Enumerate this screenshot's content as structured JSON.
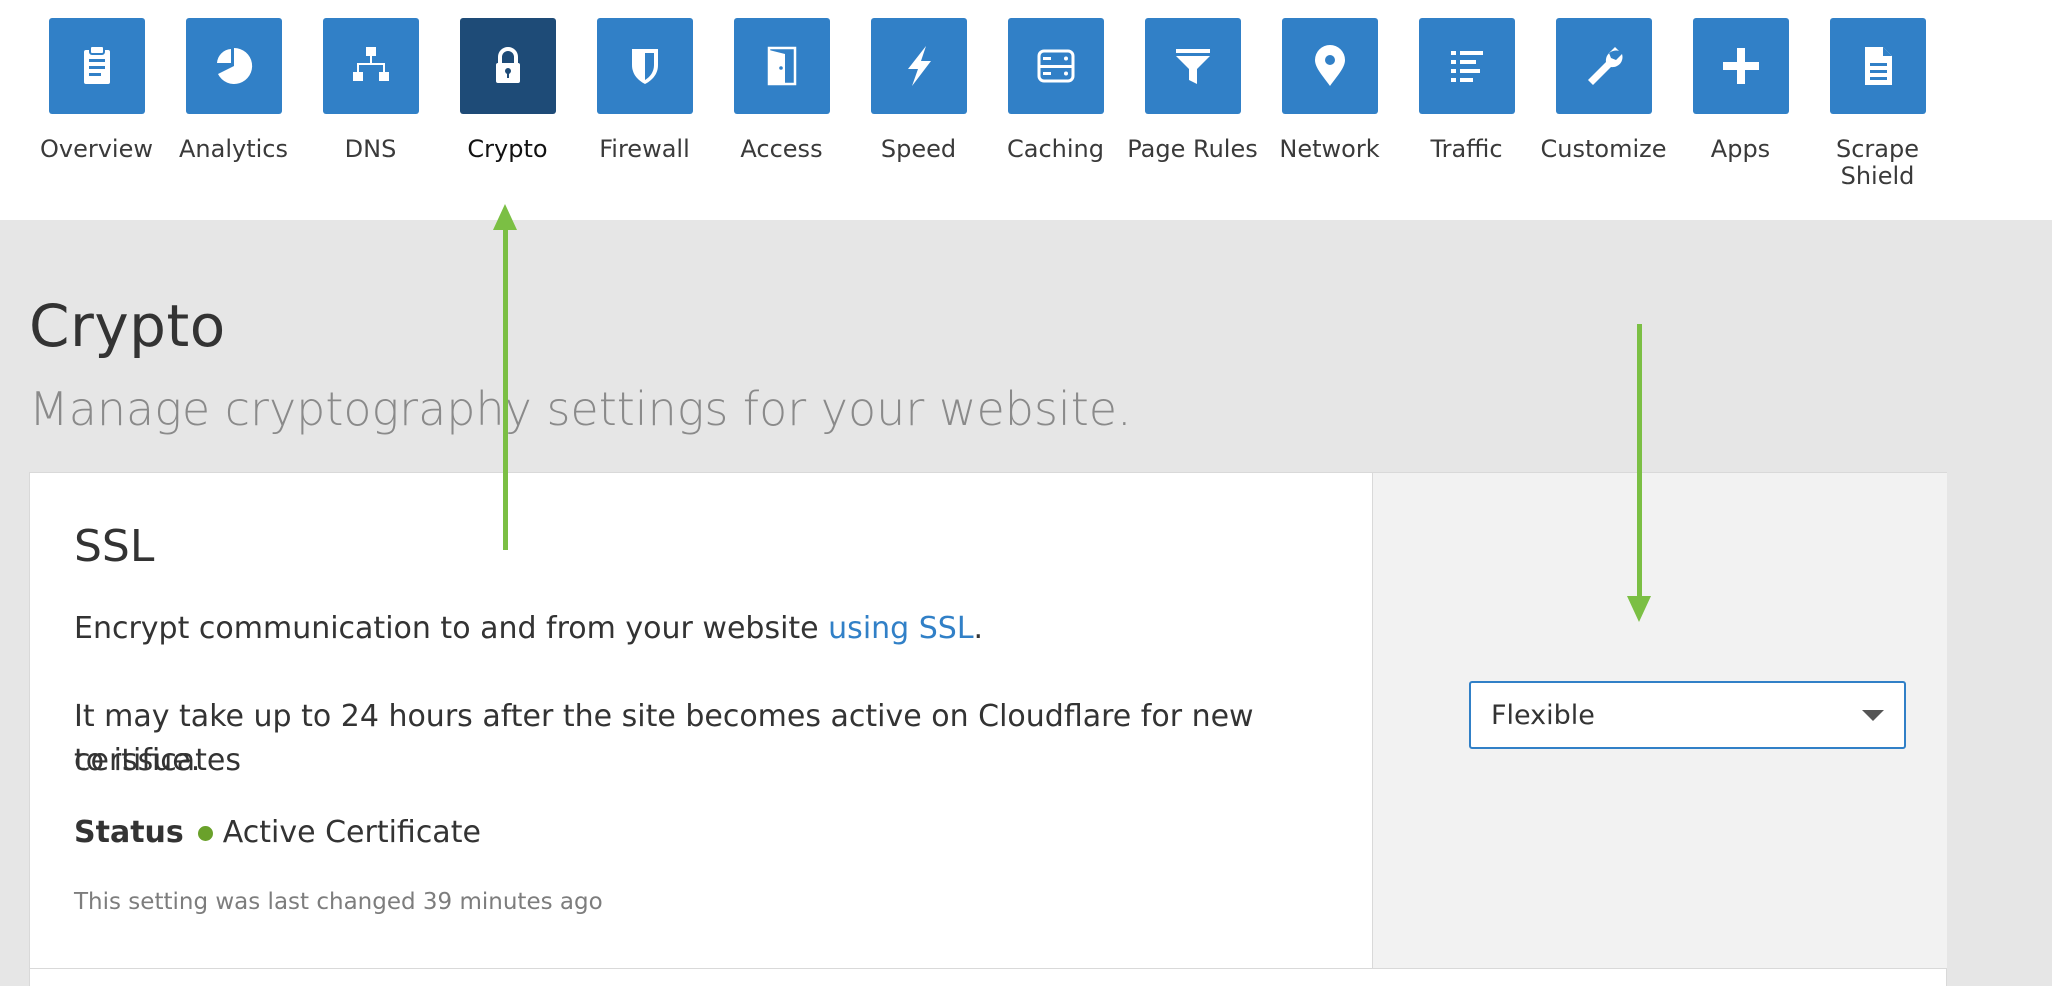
{
  "nav": {
    "items": [
      {
        "label": "Overview",
        "icon": "clipboard-icon",
        "active": false
      },
      {
        "label": "Analytics",
        "icon": "pie-chart-icon",
        "active": false
      },
      {
        "label": "DNS",
        "icon": "network-tree-icon",
        "active": false
      },
      {
        "label": "Crypto",
        "icon": "lock-icon",
        "active": true
      },
      {
        "label": "Firewall",
        "icon": "shield-icon",
        "active": false
      },
      {
        "label": "Access",
        "icon": "door-icon",
        "active": false
      },
      {
        "label": "Speed",
        "icon": "lightning-icon",
        "active": false
      },
      {
        "label": "Caching",
        "icon": "server-icon",
        "active": false
      },
      {
        "label": "Page Rules",
        "icon": "filter-icon",
        "active": false
      },
      {
        "label": "Network",
        "icon": "location-pin-icon",
        "active": false
      },
      {
        "label": "Traffic",
        "icon": "list-icon",
        "active": false
      },
      {
        "label": "Customize",
        "icon": "wrench-icon",
        "active": false
      },
      {
        "label": "Apps",
        "icon": "plus-icon",
        "active": false
      },
      {
        "label": "Scrape\nShield",
        "icon": "document-icon",
        "active": false
      }
    ]
  },
  "page": {
    "title": "Crypto",
    "subtitle": "Manage cryptography settings for your website."
  },
  "ssl": {
    "title": "SSL",
    "desc_prefix": "Encrypt communication to and from your website ",
    "desc_link": "using SSL",
    "desc_suffix": ".",
    "note_line1": "It may take up to 24 hours after the site becomes active on Cloudflare for new certificates",
    "note_line2": "to issue.",
    "status_label": "Status",
    "status_value": "Active Certificate",
    "last_changed": "This setting was last changed 39 minutes ago",
    "mode_selected": "Flexible"
  },
  "colors": {
    "tile": "#3180c7",
    "tile_active": "#1e4b77",
    "link": "#3180c7",
    "status_ok": "#6aa12b",
    "annotation_arrow": "#7bbf44"
  }
}
